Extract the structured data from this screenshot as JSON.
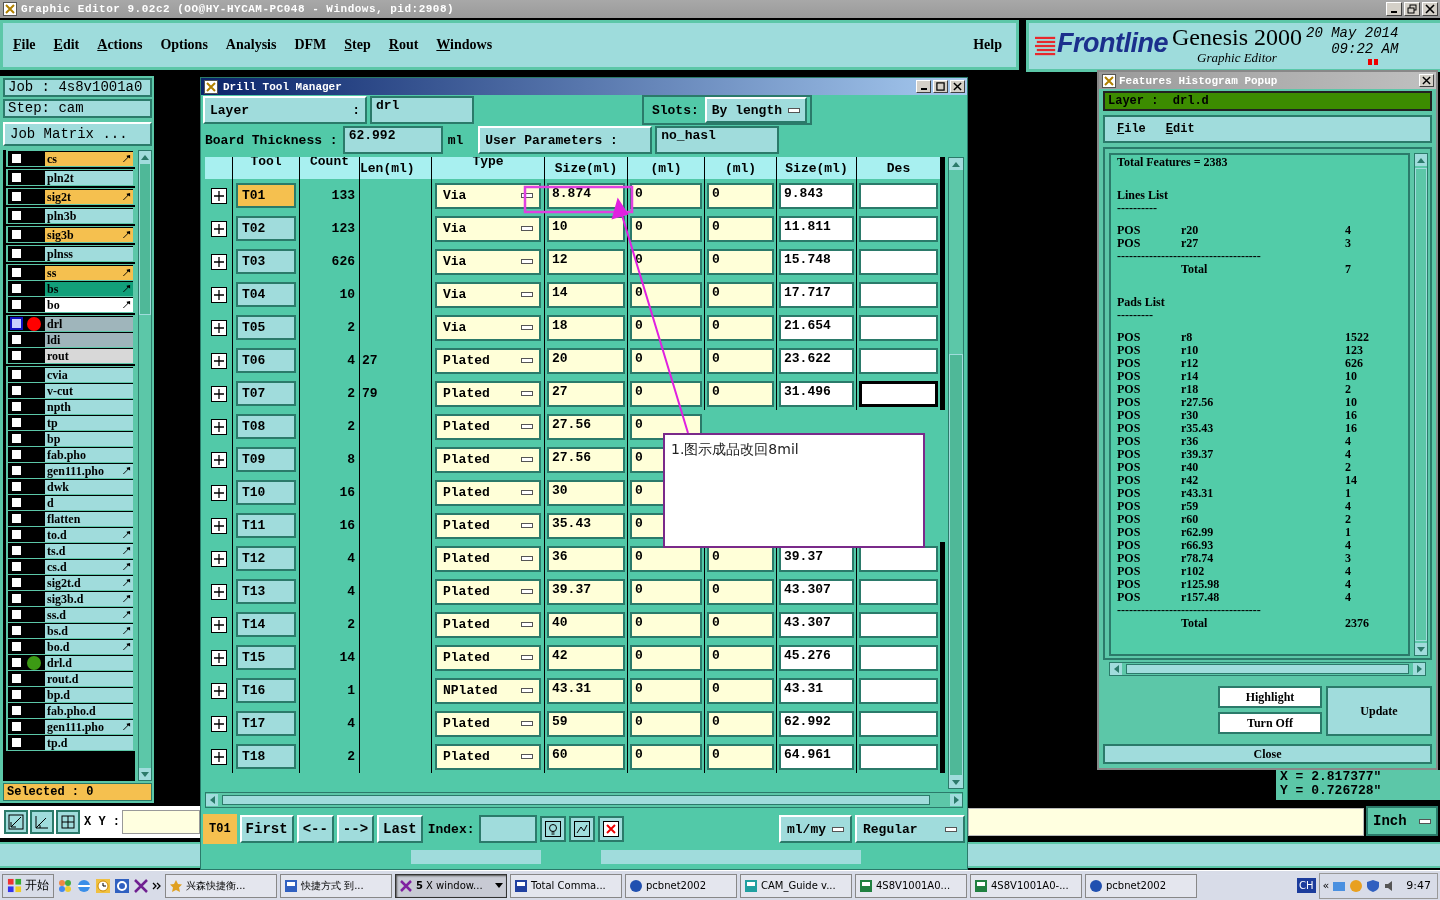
{
  "title_bar": {
    "title": "Graphic Editor 9.02c2 (OO@HY-HYCAM-PC048 - Windows, pid:2908)"
  },
  "menu": [
    {
      "label": "File",
      "mnemonic": true
    },
    {
      "label": "Edit",
      "mnemonic": true
    },
    {
      "label": "Actions",
      "mnemonic": true
    },
    {
      "label": "Options",
      "mnemonic": false
    },
    {
      "label": "Analysis",
      "mnemonic": false
    },
    {
      "label": "DFM",
      "mnemonic": false
    },
    {
      "label": "Step",
      "mnemonic": true
    },
    {
      "label": "Rout",
      "mnemonic": true
    },
    {
      "label": "Windows",
      "mnemonic": true
    }
  ],
  "help": "Help",
  "brand": {
    "logo": "Frontline",
    "product": "Genesis 2000",
    "date": "20 May 2014",
    "time": "09:22 AM",
    "subtitle": "Graphic Editor"
  },
  "job_panel": {
    "job": "Job : 4s8v1001a0",
    "step": "Step: cam",
    "matrix_button": "Job Matrix ...",
    "selected_count": "Selected : 0",
    "groups": [
      {
        "layers": [
          {
            "name": "cs",
            "kind": "signal",
            "editable": true,
            "selected": false
          }
        ]
      },
      {
        "layers": [
          {
            "name": "pln2t",
            "kind": "misc",
            "editable": false,
            "selected": false
          }
        ]
      },
      {
        "layers": [
          {
            "name": "sig2t",
            "kind": "signal",
            "editable": true,
            "selected": false
          }
        ]
      },
      {
        "layers": [
          {
            "name": "pln3b",
            "kind": "misc",
            "editable": false,
            "selected": false
          }
        ]
      },
      {
        "layers": [
          {
            "name": "sig3b",
            "kind": "signal",
            "editable": true,
            "selected": false
          }
        ]
      },
      {
        "layers": [
          {
            "name": "plnss",
            "kind": "misc",
            "editable": false,
            "selected": false
          }
        ]
      },
      {
        "layers": [
          {
            "name": "ss",
            "kind": "signal",
            "editable": true,
            "selected": false
          },
          {
            "name": "bs",
            "kind": "mask",
            "editable": true,
            "selected": false
          },
          {
            "name": "bo",
            "kind": "silk",
            "editable": true,
            "selected": false
          }
        ]
      },
      {
        "layers": [
          {
            "name": "drl",
            "kind": "drill",
            "editable": false,
            "selected": true,
            "color": "#ff0000"
          },
          {
            "name": "ldi",
            "kind": "drill",
            "editable": false,
            "selected": false
          },
          {
            "name": "rout",
            "kind": "rout",
            "editable": false,
            "selected": false
          }
        ]
      },
      {
        "layers": [
          {
            "name": "cvia",
            "kind": "misc",
            "editable": false,
            "selected": false
          },
          {
            "name": "v-cut",
            "kind": "misc",
            "editable": false,
            "selected": false
          },
          {
            "name": "npth",
            "kind": "misc",
            "editable": false,
            "selected": false
          },
          {
            "name": "tp",
            "kind": "misc",
            "editable": false,
            "selected": false
          },
          {
            "name": "bp",
            "kind": "misc",
            "editable": false,
            "selected": false
          },
          {
            "name": "fab.pho",
            "kind": "misc",
            "editable": false,
            "selected": false
          },
          {
            "name": "gen111.pho",
            "kind": "misc",
            "editable": true,
            "selected": false
          },
          {
            "name": "dwk",
            "kind": "misc",
            "editable": false,
            "selected": false
          },
          {
            "name": "d",
            "kind": "misc",
            "editable": false,
            "selected": false
          },
          {
            "name": "flatten",
            "kind": "misc",
            "editable": false,
            "selected": false
          },
          {
            "name": "to.d",
            "kind": "misc",
            "editable": true,
            "selected": false
          },
          {
            "name": "ts.d",
            "kind": "misc",
            "editable": true,
            "selected": false
          },
          {
            "name": "cs.d",
            "kind": "misc",
            "editable": true,
            "selected": false
          },
          {
            "name": "sig2t.d",
            "kind": "misc",
            "editable": true,
            "selected": false
          },
          {
            "name": "sig3b.d",
            "kind": "misc",
            "editable": true,
            "selected": false
          },
          {
            "name": "ss.d",
            "kind": "misc",
            "editable": true,
            "selected": false
          },
          {
            "name": "bs.d",
            "kind": "misc",
            "editable": true,
            "selected": false
          },
          {
            "name": "bo.d",
            "kind": "misc",
            "editable": true,
            "selected": false
          },
          {
            "name": "drl.d",
            "kind": "misc",
            "editable": false,
            "selected": false,
            "color": "#3c9a14"
          },
          {
            "name": "rout.d",
            "kind": "misc",
            "editable": false,
            "selected": false
          },
          {
            "name": "bp.d",
            "kind": "misc",
            "editable": false,
            "selected": false
          },
          {
            "name": "fab.pho.d",
            "kind": "misc",
            "editable": false,
            "selected": false
          },
          {
            "name": "gen111.pho",
            "kind": "misc",
            "editable": true,
            "selected": false
          },
          {
            "name": "tp.d",
            "kind": "misc",
            "editable": false,
            "selected": false
          }
        ]
      }
    ]
  },
  "drill_tool_manager": {
    "title": "Drill Tool Manager",
    "layer_label": "Layer",
    "layer_colon": ":",
    "layer": "drl",
    "slots_label": "Slots:",
    "slots": "By length",
    "thickness_label": "Board Thickness :",
    "thickness": "62.992",
    "thickness_unit": "ml",
    "user_params_button": "User Parameters :",
    "user_params": "no_hasl",
    "columns": [
      "Tool",
      "Count",
      "Len(ml)",
      "Type",
      "Size(ml)",
      "(ml)",
      "(ml)",
      "Size(ml)",
      "Des"
    ],
    "rows": [
      {
        "tool": "T01",
        "selected": true,
        "count": "133",
        "len": "",
        "type": "Via",
        "size": "8.874",
        "c6": "0",
        "c7": "0",
        "size2": "9.843",
        "des_focused": false
      },
      {
        "tool": "T02",
        "selected": false,
        "count": "123",
        "len": "",
        "type": "Via",
        "size": "10",
        "c6": "0",
        "c7": "0",
        "size2": "11.811",
        "des_focused": false
      },
      {
        "tool": "T03",
        "selected": false,
        "count": "626",
        "len": "",
        "type": "Via",
        "size": "12",
        "c6": "0",
        "c7": "0",
        "size2": "15.748",
        "des_focused": false
      },
      {
        "tool": "T04",
        "selected": false,
        "count": "10",
        "len": "",
        "type": "Via",
        "size": "14",
        "c6": "0",
        "c7": "0",
        "size2": "17.717",
        "des_focused": false
      },
      {
        "tool": "T05",
        "selected": false,
        "count": "2",
        "len": "",
        "type": "Via",
        "size": "18",
        "c6": "0",
        "c7": "0",
        "size2": "21.654",
        "des_focused": false
      },
      {
        "tool": "T06",
        "selected": false,
        "count": "4",
        "len": "27",
        "type": "Plated",
        "size": "20",
        "c6": "0",
        "c7": "0",
        "size2": "23.622",
        "des_focused": false
      },
      {
        "tool": "T07",
        "selected": false,
        "count": "2",
        "len": "79",
        "type": "Plated",
        "size": "27",
        "c6": "0",
        "c7": "0",
        "size2": "31.496",
        "des_focused": true
      },
      {
        "tool": "T08",
        "selected": false,
        "count": "2",
        "len": "",
        "type": "Plated",
        "size": "27.56",
        "c6": "0"
      },
      {
        "tool": "T09",
        "selected": false,
        "count": "8",
        "len": "",
        "type": "Plated",
        "size": "27.56",
        "c6": "0"
      },
      {
        "tool": "T10",
        "selected": false,
        "count": "16",
        "len": "",
        "type": "Plated",
        "size": "30",
        "c6": "0"
      },
      {
        "tool": "T11",
        "selected": false,
        "count": "16",
        "len": "",
        "type": "Plated",
        "size": "35.43",
        "c6": "0"
      },
      {
        "tool": "T12",
        "selected": false,
        "count": "4",
        "len": "",
        "type": "Plated",
        "size": "36",
        "c6": "0",
        "c7": "0",
        "size2": "39.37",
        "des_focused": false
      },
      {
        "tool": "T13",
        "selected": false,
        "count": "4",
        "len": "",
        "type": "Plated",
        "size": "39.37",
        "c6": "0",
        "c7": "0",
        "size2": "43.307",
        "des_focused": false
      },
      {
        "tool": "T14",
        "selected": false,
        "count": "2",
        "len": "",
        "type": "Plated",
        "size": "40",
        "c6": "0",
        "c7": "0",
        "size2": "43.307",
        "des_focused": false
      },
      {
        "tool": "T15",
        "selected": false,
        "count": "14",
        "len": "",
        "type": "Plated",
        "size": "42",
        "c6": "0",
        "c7": "0",
        "size2": "45.276",
        "des_focused": false
      },
      {
        "tool": "T16",
        "selected": false,
        "count": "1",
        "len": "",
        "type": "NPlated",
        "size": "43.31",
        "c6": "0",
        "c7": "0",
        "size2": "43.31",
        "des_focused": false
      },
      {
        "tool": "T17",
        "selected": false,
        "count": "4",
        "len": "",
        "type": "Plated",
        "size": "59",
        "c6": "0",
        "c7": "0",
        "size2": "62.992",
        "des_focused": false
      },
      {
        "tool": "T18",
        "selected": false,
        "count": "2",
        "len": "",
        "type": "Plated",
        "size": "60",
        "c6": "0",
        "c7": "0",
        "size2": "64.961",
        "des_focused": false
      }
    ],
    "current_tool": "T01",
    "nav_buttons": [
      "First",
      "<--",
      "-->",
      "Last"
    ],
    "index_label": "Index:",
    "units": "ml/my",
    "mode": "Regular"
  },
  "annotation": {
    "note": "1.图示成品改回8mil"
  },
  "histogram_popup": {
    "title": "Features Histogram Popup",
    "layer": "Layer :  drl.d",
    "menu": [
      "File",
      "Edit"
    ],
    "total_features": "Total Features = 2383",
    "sections": [
      {
        "title": "Lines List",
        "underline": "----------",
        "rows": [
          [
            "POS",
            "r20",
            "4"
          ],
          [
            "POS",
            "r27",
            "3"
          ]
        ],
        "separator": "------------------------------------",
        "total_label": "Total",
        "total": "7"
      },
      {
        "title": "Pads List",
        "underline": "---------",
        "rows": [
          [
            "POS",
            "r8",
            "1522"
          ],
          [
            "POS",
            "r10",
            "123"
          ],
          [
            "POS",
            "r12",
            "626"
          ],
          [
            "POS",
            "r14",
            "10"
          ],
          [
            "POS",
            "r18",
            "2"
          ],
          [
            "POS",
            "r27.56",
            "10"
          ],
          [
            "POS",
            "r30",
            "16"
          ],
          [
            "POS",
            "r35.43",
            "16"
          ],
          [
            "POS",
            "r36",
            "4"
          ],
          [
            "POS",
            "r39.37",
            "4"
          ],
          [
            "POS",
            "r40",
            "2"
          ],
          [
            "POS",
            "r42",
            "14"
          ],
          [
            "POS",
            "r43.31",
            "1"
          ],
          [
            "POS",
            "r59",
            "4"
          ],
          [
            "POS",
            "r60",
            "2"
          ],
          [
            "POS",
            "r62.99",
            "1"
          ],
          [
            "POS",
            "r66.93",
            "4"
          ],
          [
            "POS",
            "r78.74",
            "3"
          ],
          [
            "POS",
            "r102",
            "4"
          ],
          [
            "POS",
            "r125.98",
            "4"
          ],
          [
            "POS",
            "r157.48",
            "4"
          ]
        ],
        "separator": "------------------------------------",
        "total_label": "Total",
        "total": "2376"
      }
    ],
    "buttons": {
      "highlight": "Highlight",
      "turn_off": "Turn Off",
      "update": "Update",
      "close": "Close"
    }
  },
  "coordinates": {
    "x": "X = 2.817377\"",
    "y": "Y = 0.726728\""
  },
  "bottom_toolbar": {
    "xy_label": "X Y :",
    "units": "Inch"
  },
  "taskbar": {
    "start": "开始",
    "tasks": [
      {
        "label": "兴森快捷衡...",
        "kind": "star",
        "selected": false
      },
      {
        "label": "快捷方式 到...",
        "kind": "shortcut",
        "selected": false
      },
      {
        "count": "5",
        "label": "X window...",
        "kind": "x",
        "selected": true
      },
      {
        "label": "Total Comma...",
        "kind": "disk",
        "selected": false
      },
      {
        "label": "pcbnet2002",
        "kind": "globe",
        "selected": false
      },
      {
        "label": "CAM_Guide v...",
        "kind": "cam",
        "selected": false
      },
      {
        "label": "4S8V1001A0...",
        "kind": "sheet",
        "selected": false
      },
      {
        "label": "4S8V1001A0-...",
        "kind": "sheet",
        "selected": false
      },
      {
        "label": "pcbnet2002",
        "kind": "globe",
        "selected": false
      }
    ],
    "language": "CH",
    "expand": "«",
    "clock": "9:47"
  }
}
